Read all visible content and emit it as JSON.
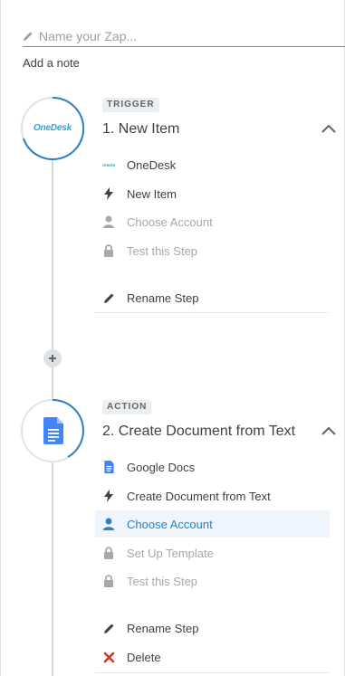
{
  "zap": {
    "name_placeholder": "Name your Zap...",
    "add_note": "Add a note"
  },
  "steps": [
    {
      "badge": "TRIGGER",
      "title": "1. New Item",
      "app_logo_text": "OneDesk",
      "rows": [
        {
          "label": "OneDesk",
          "icon": "onedesk-logo-icon",
          "state": "normal"
        },
        {
          "label": "New Item",
          "icon": "lightning-icon",
          "state": "normal"
        },
        {
          "label": "Choose Account",
          "icon": "user-icon",
          "state": "muted"
        },
        {
          "label": "Test this Step",
          "icon": "lock-icon",
          "state": "muted"
        }
      ],
      "actions": [
        {
          "label": "Rename Step",
          "icon": "pencil-icon"
        }
      ]
    },
    {
      "badge": "ACTION",
      "title": "2. Create Document from Text",
      "rows": [
        {
          "label": "Google Docs",
          "icon": "google-docs-icon",
          "state": "normal"
        },
        {
          "label": "Create Document from Text",
          "icon": "lightning-icon",
          "state": "normal"
        },
        {
          "label": "Choose Account",
          "icon": "user-icon",
          "state": "active"
        },
        {
          "label": "Set Up Template",
          "icon": "lock-icon",
          "state": "muted"
        },
        {
          "label": "Test this Step",
          "icon": "lock-icon",
          "state": "muted"
        }
      ],
      "actions": [
        {
          "label": "Rename Step",
          "icon": "pencil-icon"
        },
        {
          "label": "Delete",
          "icon": "delete-x-icon"
        }
      ]
    }
  ],
  "colors": {
    "accent_green": "#4ca96b",
    "accent_blue": "#2d7fc4",
    "onedesk_blue": "#25a3dc",
    "docs_blue": "#4285f4",
    "delete_red": "#e0301e"
  }
}
